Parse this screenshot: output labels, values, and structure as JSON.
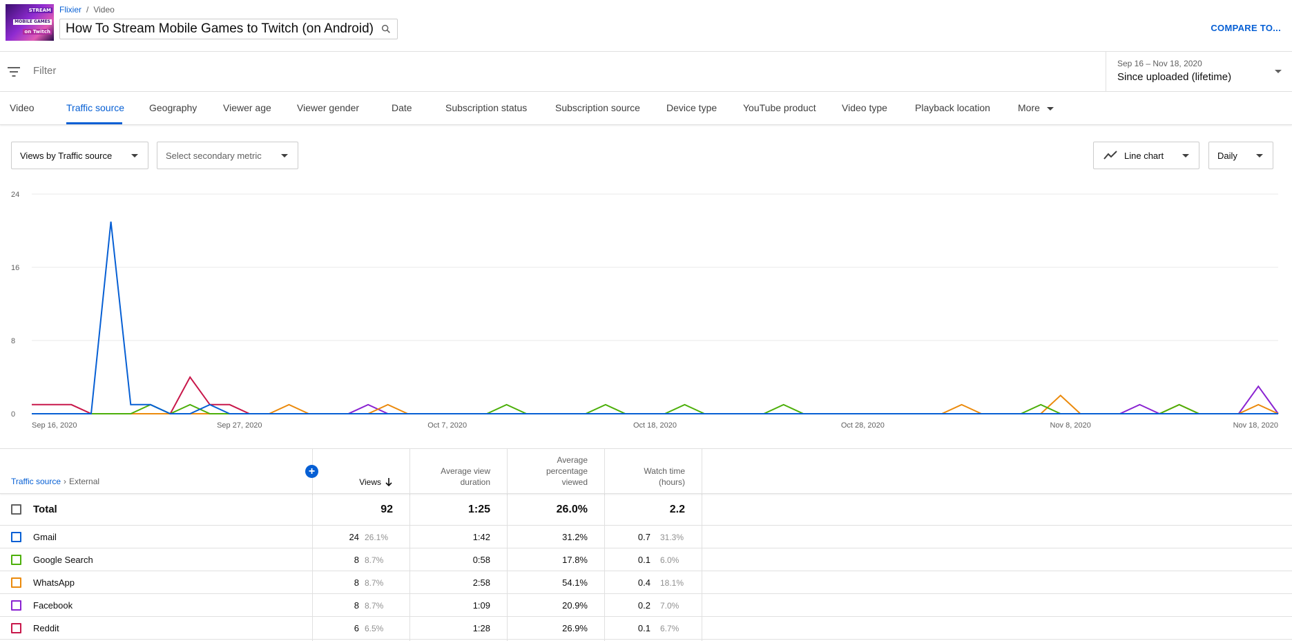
{
  "header": {
    "breadcrumb": {
      "channel": "Flixier",
      "separator": "/",
      "section": "Video"
    },
    "video_title": "How To Stream Mobile Games to Twitch (on Android)",
    "thumbnail_text": {
      "line1": "STREAM",
      "line2": "MOBILE GAMES",
      "line3": "on Twitch"
    },
    "compare_label": "COMPARE TO..."
  },
  "filter": {
    "placeholder": "Filter"
  },
  "date_range": {
    "range": "Sep 16 – Nov 18, 2020",
    "label": "Since uploaded (lifetime)"
  },
  "tabs": [
    {
      "label": "Video"
    },
    {
      "label": "Traffic source",
      "active": true
    },
    {
      "label": "Geography"
    },
    {
      "label": "Viewer age"
    },
    {
      "label": "Viewer gender"
    },
    {
      "label": "Date"
    },
    {
      "label": "Subscription status"
    },
    {
      "label": "Subscription source"
    },
    {
      "label": "Device type"
    },
    {
      "label": "YouTube product"
    },
    {
      "label": "Video type"
    },
    {
      "label": "Playback location"
    },
    {
      "label": "More"
    }
  ],
  "controls": {
    "primary_metric": "Views by Traffic source",
    "secondary_metric": "Select secondary metric",
    "chart_type": "Line chart",
    "granularity": "Daily"
  },
  "chart_data": {
    "type": "line",
    "x_start": "Sep 16, 2020",
    "x_end": "Nov 18, 2020",
    "x_tick_labels": [
      "Sep 16, 2020",
      "Sep 27, 2020",
      "Oct 7, 2020",
      "Oct 18, 2020",
      "Oct 28, 2020",
      "Nov 8, 2020",
      "Nov 18, 2020"
    ],
    "y_ticks": [
      0,
      8,
      16,
      24
    ],
    "ylim": [
      0,
      24
    ],
    "grid": true,
    "series": [
      {
        "name": "Gmail",
        "color": "#065fd4",
        "values": [
          0,
          0,
          0,
          0,
          21,
          1,
          1,
          0,
          0,
          1,
          0,
          0,
          0,
          0,
          0,
          0,
          0,
          0,
          0,
          0,
          0,
          0,
          0,
          0,
          0,
          0,
          0,
          0,
          0,
          0,
          0,
          0,
          0,
          0,
          0,
          0,
          0,
          0,
          0,
          0,
          0,
          0,
          0,
          0,
          0,
          0,
          0,
          0,
          0,
          0,
          0,
          0,
          0,
          0,
          0,
          0,
          0,
          0,
          0,
          0,
          0,
          0,
          0,
          0
        ]
      },
      {
        "name": "Google Search",
        "color": "#4caf0a",
        "values": [
          0,
          0,
          0,
          0,
          0,
          0,
          1,
          0,
          1,
          0,
          0,
          0,
          0,
          0,
          0,
          0,
          0,
          0,
          0,
          0,
          0,
          0,
          0,
          0,
          1,
          0,
          0,
          0,
          0,
          1,
          0,
          0,
          0,
          1,
          0,
          0,
          0,
          0,
          1,
          0,
          0,
          0,
          0,
          0,
          0,
          0,
          0,
          0,
          0,
          0,
          0,
          1,
          0,
          0,
          0,
          0,
          0,
          0,
          1,
          0,
          0,
          0,
          0,
          0
        ]
      },
      {
        "name": "WhatsApp",
        "color": "#eb8a0c",
        "values": [
          0,
          0,
          0,
          0,
          0,
          0,
          0,
          0,
          0,
          0,
          0,
          0,
          0,
          1,
          0,
          0,
          0,
          0,
          1,
          0,
          0,
          0,
          0,
          0,
          0,
          0,
          0,
          0,
          0,
          0,
          0,
          0,
          0,
          0,
          0,
          0,
          0,
          0,
          0,
          0,
          0,
          0,
          0,
          0,
          0,
          0,
          0,
          1,
          0,
          0,
          0,
          0,
          2,
          0,
          0,
          0,
          0,
          0,
          1,
          0,
          0,
          0,
          1,
          0
        ]
      },
      {
        "name": "Facebook",
        "color": "#8a23d1",
        "values": [
          0,
          0,
          0,
          0,
          0,
          0,
          0,
          0,
          0,
          0,
          0,
          0,
          0,
          0,
          0,
          0,
          0,
          1,
          0,
          0,
          0,
          0,
          0,
          0,
          0,
          0,
          0,
          0,
          0,
          0,
          0,
          0,
          0,
          0,
          0,
          0,
          0,
          0,
          0,
          0,
          0,
          0,
          0,
          0,
          0,
          0,
          0,
          0,
          0,
          0,
          0,
          0,
          0,
          0,
          0,
          0,
          1,
          0,
          0,
          0,
          0,
          0,
          3,
          0
        ]
      },
      {
        "name": "Reddit",
        "color": "#c8174a",
        "values": [
          1,
          1,
          1,
          0,
          0,
          0,
          0,
          0,
          4,
          1,
          1,
          0,
          0,
          0,
          0,
          0,
          0,
          0,
          0,
          0,
          0,
          0,
          0,
          0,
          0,
          0,
          0,
          0,
          0,
          0,
          0,
          0,
          0,
          0,
          0,
          0,
          0,
          0,
          0,
          0,
          0,
          0,
          0,
          0,
          0,
          0,
          0,
          0,
          0,
          0,
          0,
          0,
          0,
          0,
          0,
          0,
          0,
          0,
          0,
          0,
          0,
          0,
          0,
          0
        ]
      }
    ]
  },
  "table": {
    "dimension_label": "Traffic source",
    "dimension_sub": "External",
    "add_label": "+",
    "columns": {
      "views": "Views",
      "avd_line1": "Average view",
      "avd_line2": "duration",
      "apv_line1": "Average",
      "apv_line2": "percentage",
      "apv_line3": "viewed",
      "wt_line1": "Watch time",
      "wt_line2": "(hours)"
    },
    "total": {
      "label": "Total",
      "views": "92",
      "avd": "1:25",
      "apv": "26.0%",
      "wt": "2.2"
    },
    "rows": [
      {
        "name": "Gmail",
        "color": "#065fd4",
        "views": "24",
        "views_pct": "26.1%",
        "avd": "1:42",
        "apv": "31.2%",
        "wt": "0.7",
        "wt_pct": "31.3%"
      },
      {
        "name": "Google Search",
        "color": "#4caf0a",
        "views": "8",
        "views_pct": "8.7%",
        "avd": "0:58",
        "apv": "17.8%",
        "wt": "0.1",
        "wt_pct": "6.0%"
      },
      {
        "name": "WhatsApp",
        "color": "#eb8a0c",
        "views": "8",
        "views_pct": "8.7%",
        "avd": "2:58",
        "apv": "54.1%",
        "wt": "0.4",
        "wt_pct": "18.1%"
      },
      {
        "name": "Facebook",
        "color": "#8a23d1",
        "views": "8",
        "views_pct": "8.7%",
        "avd": "1:09",
        "apv": "20.9%",
        "wt": "0.2",
        "wt_pct": "7.0%"
      },
      {
        "name": "Reddit",
        "color": "#c8174a",
        "views": "6",
        "views_pct": "6.5%",
        "avd": "1:28",
        "apv": "26.9%",
        "wt": "0.1",
        "wt_pct": "6.7%"
      }
    ]
  }
}
